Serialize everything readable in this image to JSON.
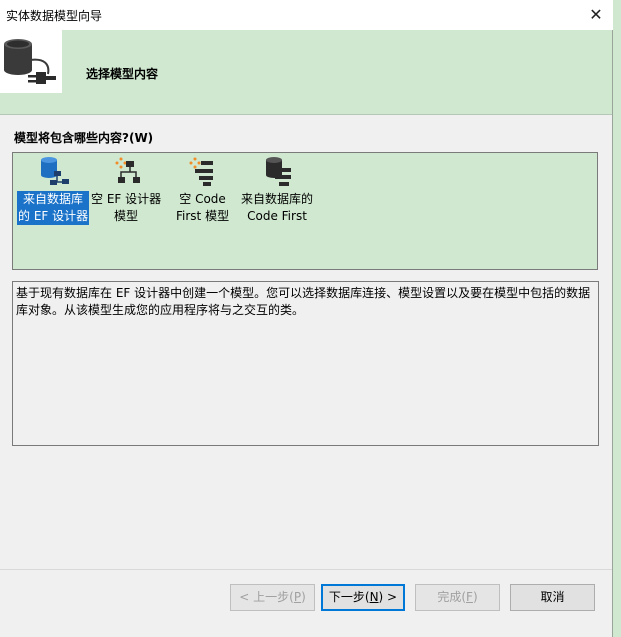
{
  "window": {
    "title": "实体数据模型向导",
    "close_glyph": "✕"
  },
  "banner": {
    "title": "选择模型内容"
  },
  "question": "模型将包含哪些内容?(W)",
  "options": [
    {
      "line1": "来自数据库",
      "line2": "的 EF 设计器",
      "icon": "database-designer-icon",
      "selected": true
    },
    {
      "line1": "空 EF 设计器",
      "line2": "模型",
      "icon": "empty-designer-icon",
      "selected": false
    },
    {
      "line1": "空 Code",
      "line2": "First 模型",
      "icon": "empty-code-first-icon",
      "selected": false
    },
    {
      "line1": "来自数据库的",
      "line2": "Code First",
      "icon": "database-code-first-icon",
      "selected": false
    }
  ],
  "description": "基于现有数据库在 EF 设计器中创建一个模型。您可以选择数据库连接、模型设置以及要在模型中包括的数据库对象。从该模型生成您的应用程序将与之交互的类。",
  "buttons": {
    "prev": {
      "pre": "< 上一步(",
      "key": "P",
      "post": ")"
    },
    "next": {
      "pre": "下一步(",
      "key": "N",
      "post": ") >"
    },
    "finish": {
      "pre": "完成(",
      "key": "F",
      "post": ")"
    },
    "cancel": {
      "label": "取消"
    }
  },
  "colors": {
    "banner_bg": "#cfe8cf",
    "selection": "#1a72c9",
    "accent": "#0078d7"
  }
}
